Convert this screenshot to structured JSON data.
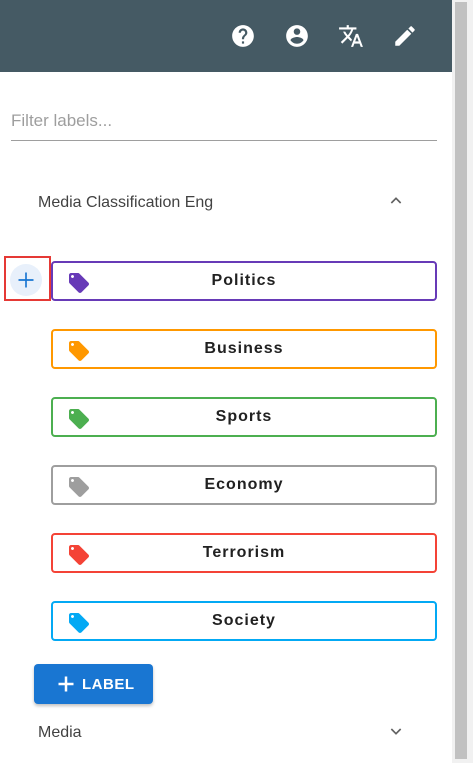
{
  "toolbar": {
    "icons": [
      "help-icon",
      "account-icon",
      "translate-icon",
      "edit-icon"
    ],
    "color": "#455a64"
  },
  "filter": {
    "placeholder": "Filter labels..."
  },
  "groups": [
    {
      "title": "Media Classification Eng",
      "expanded": true,
      "labels": [
        {
          "name": "Politics",
          "color": "#673ab7"
        },
        {
          "name": "Business",
          "color": "#ff9800"
        },
        {
          "name": "Sports",
          "color": "#4caf50"
        },
        {
          "name": "Economy",
          "color": "#9e9e9e"
        },
        {
          "name": "Terrorism",
          "color": "#f44336"
        },
        {
          "name": "Society",
          "color": "#03a9f4"
        }
      ]
    },
    {
      "title": "Media",
      "expanded": false
    }
  ],
  "add_label_button": {
    "label": "LABEL",
    "color": "#1976d2"
  }
}
